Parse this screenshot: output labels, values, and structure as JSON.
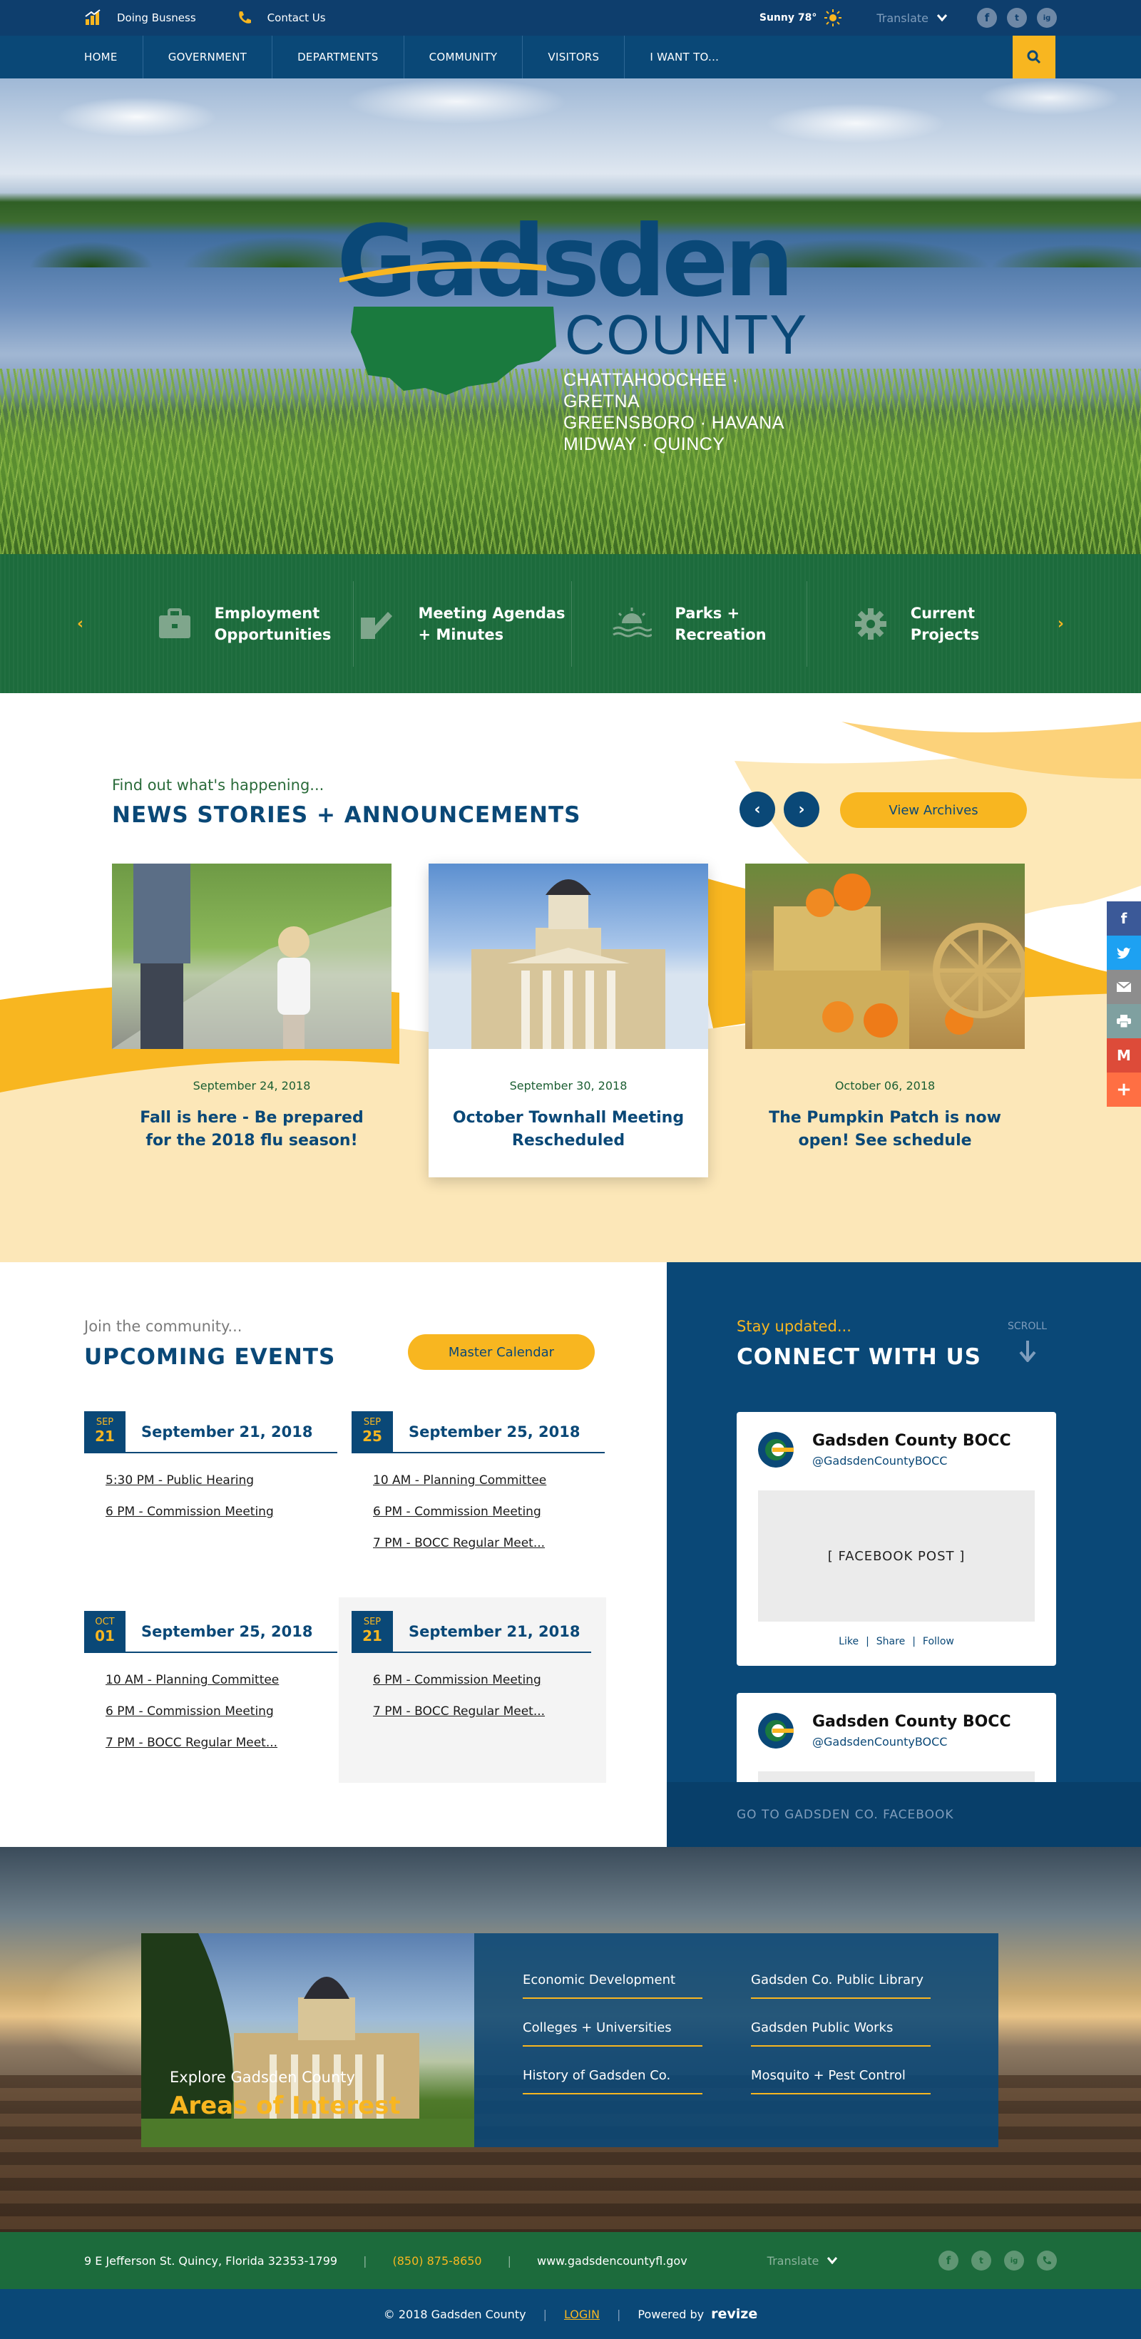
{
  "topbar": {
    "doing_business": "Doing Busness",
    "contact": "Contact Us",
    "weather": "Sunny 78°",
    "translate": "Translate",
    "social": [
      "f",
      "t",
      "ig"
    ]
  },
  "nav": {
    "items": [
      "HOME",
      "GOVERNMENT",
      "DEPARTMENTS",
      "COMMUNITY",
      "VISITORS",
      "I WANT TO..."
    ]
  },
  "hero": {
    "wordmark": "Gadsden",
    "county": "COUNTY",
    "towns": [
      "CHATTAHOOCHEE · GRETNA",
      "GREENSBORO · HAVANA",
      "MIDWAY · QUINCY"
    ]
  },
  "quick": {
    "items": [
      {
        "label": "Employment\nOpportunities",
        "icon": "briefcase-icon"
      },
      {
        "label": "Meeting Agendas\n+ Minutes",
        "icon": "edit-document-icon"
      },
      {
        "label": "Parks +\nRecreation",
        "icon": "sunset-waves-icon"
      },
      {
        "label": "Current\nProjects",
        "icon": "gear-icon"
      }
    ]
  },
  "news": {
    "kicker": "Find out what's happening...",
    "title": "NEWS STORIES + ANNOUNCEMENTS",
    "archives": "View Archives",
    "cards": [
      {
        "date": "September 24, 2018",
        "title": "Fall is here - Be prepared for the 2018 flu season!"
      },
      {
        "date": "September 30, 2018",
        "title": "October Townhall Meeting Rescheduled"
      },
      {
        "date": "October 06, 2018",
        "title": "The Pumpkin Patch is now open! See schedule"
      }
    ]
  },
  "events": {
    "kicker": "Join the community...",
    "title": "UPCOMING EVENTS",
    "master": "Master Calendar",
    "groups": [
      {
        "month": "SEP",
        "day": "21",
        "date": "September 21, 2018",
        "items": [
          "5:30 PM - Public Hearing",
          "6 PM - Commission Meeting"
        ]
      },
      {
        "month": "SEP",
        "day": "25",
        "date": "September 25, 2018",
        "items": [
          "10 AM - Planning Committee",
          "6 PM - Commission Meeting",
          "7 PM - BOCC Regular Meet..."
        ]
      },
      {
        "month": "OCT",
        "day": "01",
        "date": "September 25, 2018",
        "items": [
          "10 AM - Planning Committee",
          "6 PM - Commission Meeting",
          "7 PM - BOCC Regular Meet..."
        ]
      },
      {
        "month": "SEP",
        "day": "21",
        "date": "September 21, 2018",
        "items": [
          "6 PM - Commission Meeting",
          "7 PM - BOCC Regular Meet..."
        ]
      }
    ]
  },
  "connect": {
    "kicker": "Stay updated...",
    "title": "CONNECT WITH US",
    "scroll": "SCROLL",
    "posts": [
      {
        "name": "Gadsden County BOCC",
        "handle": "@GadsdenCountyBOCC",
        "post": "[ FACEBOOK POST ]",
        "like": "Like",
        "share": "Share",
        "follow": "Follow"
      },
      {
        "name": "Gadsden County BOCC",
        "handle": "@GadsdenCountyBOCC"
      }
    ],
    "go": "GO TO GADSDEN CO. FACEBOOK"
  },
  "areas": {
    "kicker": "Explore Gadsden County",
    "title": "Areas of Interest",
    "left": [
      "Economic Development",
      "Colleges + Universities",
      "History of Gadsden Co."
    ],
    "right": [
      "Gadsden Co. Public Library",
      "Gadsden Public Works",
      "Mosquito + Pest Control"
    ]
  },
  "footer": {
    "address": "9 E Jefferson St. Quincy, Florida 32353-1799",
    "phone": "(850) 875-8650",
    "web": "www.gadsdencountyfl.gov",
    "translate": "Translate",
    "copyright": "© 2018 Gadsden County",
    "login": "LOGIN",
    "powered": "Powered by",
    "revize": "revize"
  },
  "colors": {
    "navy": "#0a4877",
    "green": "#1c6b3c",
    "gold": "#f8b620"
  }
}
